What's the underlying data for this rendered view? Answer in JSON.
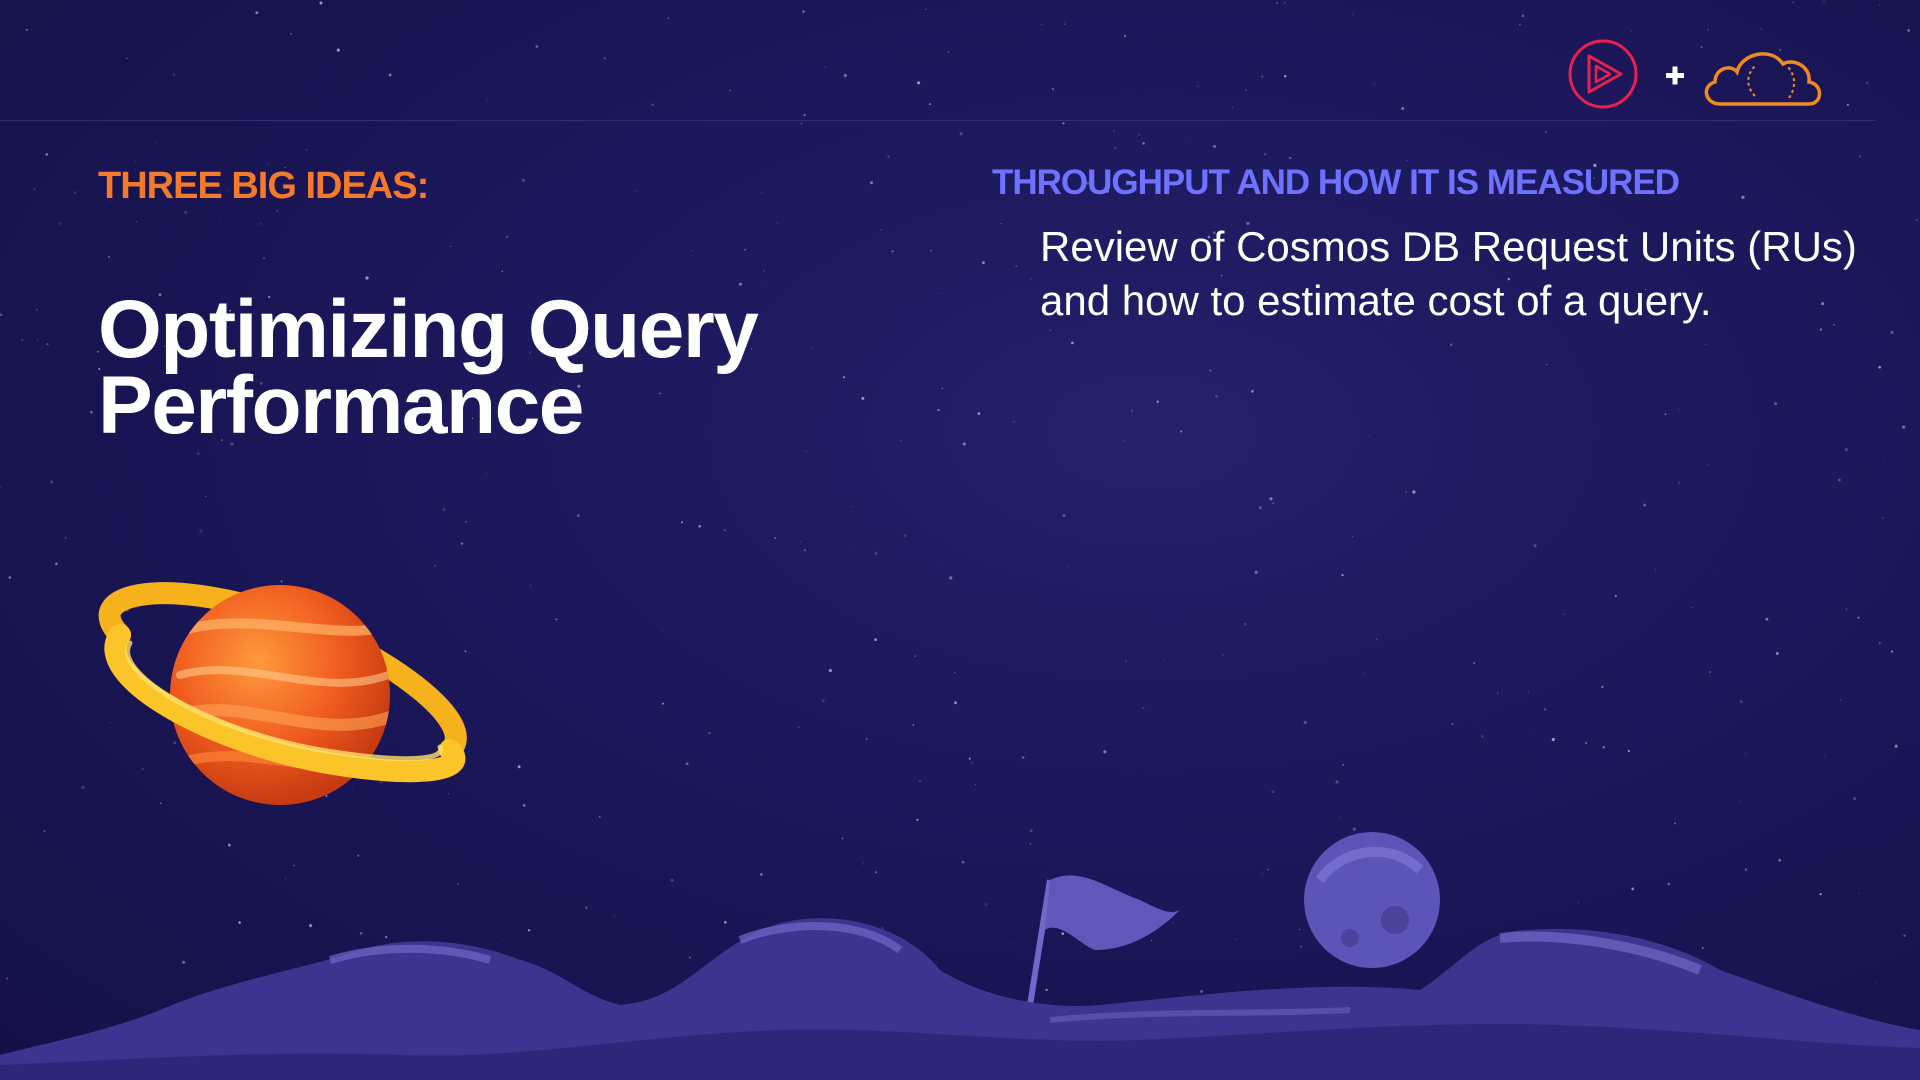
{
  "header": {
    "brand_icons": [
      "pluralsight-play-icon",
      "plus-icon",
      "cloud-icon"
    ],
    "colors": {
      "play_icon": "#e8204f",
      "cloud_icon": "#f28a22",
      "plus_icon": "#ffffff"
    }
  },
  "left": {
    "eyebrow": "THREE BIG IDEAS:",
    "title": "Optimizing Query Performance",
    "eyebrow_color": "#f27a2a"
  },
  "right": {
    "eyebrow": "THROUGHPUT AND HOW IT IS MEASURED",
    "description": "Review of Cosmos DB Request Units (RUs) and how to estimate cost of a query.",
    "eyebrow_color": "#6f72ff"
  },
  "illustration": {
    "elements": [
      "ringed-planet",
      "moon-surface",
      "flag",
      "small-moon"
    ]
  },
  "background": {
    "color": "#1b175a"
  }
}
